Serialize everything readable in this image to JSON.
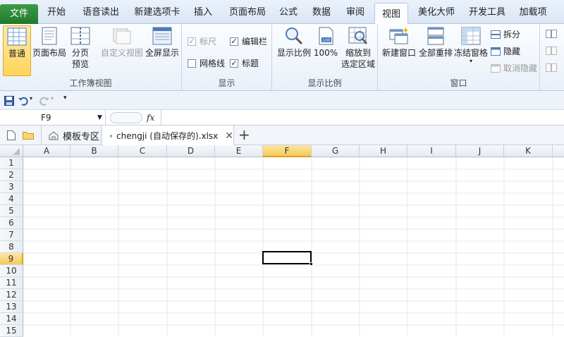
{
  "menu": {
    "file": "文件",
    "tabs": [
      "开始",
      "语音读出",
      "新建选项卡",
      "插入",
      "页面布局",
      "公式",
      "数据",
      "审阅",
      "视图",
      "美化大师",
      "开发工具",
      "加载项"
    ]
  },
  "groups": {
    "workbook_views": "工作簿视图",
    "show": "显示",
    "zoom": "显示比例",
    "window": "窗口"
  },
  "buttons": {
    "normal": "普通",
    "page_layout": "页面布局",
    "page_break_l1": "分页",
    "page_break_l2": "预览",
    "custom_view": "自定义视图",
    "full_screen": "全屏显示",
    "zoom": "显示比例",
    "zoom100": "100%",
    "zoom_sel_l1": "缩放到",
    "zoom_sel_l2": "选定区域",
    "new_window": "新建窗口",
    "arrange_all": "全部重排",
    "freeze_panes": "冻结窗格",
    "split": "拆分",
    "hide": "隐藏",
    "unhide": "取消隐藏"
  },
  "checks": {
    "ruler": "标尺",
    "formula_bar": "编辑栏",
    "gridlines": "网格线",
    "headings": "标题"
  },
  "formula": {
    "namebox": "F9",
    "fx": "fx"
  },
  "doc_tabs": {
    "template": "模板专区",
    "file": "chengji (自动保存的).xlsx"
  },
  "columns": [
    "A",
    "B",
    "C",
    "D",
    "E",
    "F",
    "G",
    "H",
    "I",
    "J",
    "K"
  ],
  "rows": [
    "1",
    "2",
    "3",
    "4",
    "5",
    "6",
    "7",
    "8",
    "9",
    "10",
    "11",
    "12",
    "13",
    "14",
    "15"
  ],
  "colors": {
    "accent": "#217a2d",
    "selected_header": "#f7c95a"
  }
}
